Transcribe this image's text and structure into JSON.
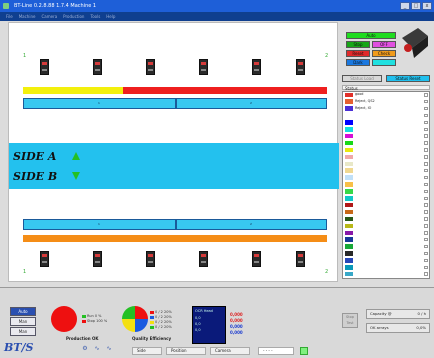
{
  "window": {
    "title": "BT-Line  0.2.8.88  1.7.4   Machine 1",
    "min": "_",
    "max": "□",
    "close": "x"
  },
  "menu": [
    "File",
    "Machine",
    "Camera",
    "Production",
    "Tools",
    "Help"
  ],
  "canvas": {
    "corners": {
      "tl": "1",
      "tr": "2",
      "bl": "1",
      "br": "2"
    },
    "side_a": "SIDE A",
    "side_b": "SIDE B",
    "top_bar": {
      "left": "1",
      "right": "2"
    },
    "bottom_bar": {
      "left": "1",
      "right": "2"
    },
    "colors": {
      "yellow": "#f3f00c",
      "red": "#ef1f1f",
      "orange": "#f58d16",
      "cyan": "#23c1ee",
      "green": "#24c024"
    }
  },
  "right_panel": {
    "buttons": {
      "auto": "Auto",
      "plus": "Stop",
      "off": "OFF",
      "reset": "Reset",
      "check": "Check",
      "dark": "Dark"
    },
    "status_load": "Status Load",
    "status_reset": "Status Reset",
    "status_label": "Status",
    "rows": [
      {
        "text": "good",
        "color": "#e0302a"
      },
      {
        "text": "Reject, QS2",
        "color": "#e66030"
      },
      {
        "text": "Reject, IO",
        "color": "#4a2fd6"
      },
      {
        "text": "",
        "color": "#ffffff"
      },
      {
        "text": "",
        "color": "#0000ff"
      },
      {
        "text": "",
        "color": "#12e0e0"
      },
      {
        "text": "",
        "color": "#d610d6"
      },
      {
        "text": "",
        "color": "#18d818"
      },
      {
        "text": "",
        "color": "#e8e810"
      },
      {
        "text": "",
        "color": "#f0a8a8"
      },
      {
        "text": "",
        "color": "#e8e8c8"
      },
      {
        "text": "",
        "color": "#f0d890"
      },
      {
        "text": "",
        "color": "#c0e0f8"
      },
      {
        "text": "",
        "color": "#f8c048"
      },
      {
        "text": "",
        "color": "#38d848"
      },
      {
        "text": "",
        "color": "#10c8c8"
      },
      {
        "text": "",
        "color": "#b01818"
      },
      {
        "text": "",
        "color": "#c86818"
      },
      {
        "text": "",
        "color": "#285818"
      },
      {
        "text": "",
        "color": "#b8b818"
      },
      {
        "text": "",
        "color": "#8818a8"
      },
      {
        "text": "",
        "color": "#183898"
      },
      {
        "text": "",
        "color": "#18a838"
      },
      {
        "text": "",
        "color": "#282828"
      },
      {
        "text": "",
        "color": "#2848b8"
      },
      {
        "text": "",
        "color": "#0898b8"
      },
      {
        "text": "",
        "color": "#38a8c8"
      }
    ]
  },
  "bottom": {
    "side_buttons": [
      "Auto",
      "Man",
      "Man"
    ],
    "production_label": "Production OK",
    "production_legend": [
      {
        "t": "Run",
        "v": "0 %"
      },
      {
        "t": "Stop",
        "v": "100 %"
      }
    ],
    "quality_label": "Quality Efficiency",
    "quality_legend": [
      {
        "t": "0 / 2",
        "v": "20%"
      },
      {
        "t": "0 / 2",
        "v": "20%"
      },
      {
        "t": "0 / 2",
        "v": "20%"
      },
      {
        "t": "0 / 2",
        "v": "20%"
      }
    ],
    "ocr": {
      "title": "OCR Head",
      "lines": [
        "0,0",
        "0,0",
        "0,0"
      ]
    },
    "red_values": [
      "0,000",
      "0,000",
      "0,000"
    ],
    "blue_values": [
      "0,000",
      "0,000",
      "0,000"
    ],
    "stop_label": "Stop\nTest",
    "counters": [
      {
        "k": "Capacity @",
        "v": "0 / h"
      },
      {
        "k": "OK arrays",
        "v": "0,0%"
      }
    ],
    "logo": "BT/S",
    "dropdowns": [
      "Side",
      "Position",
      "Camera",
      "- - - -"
    ]
  }
}
